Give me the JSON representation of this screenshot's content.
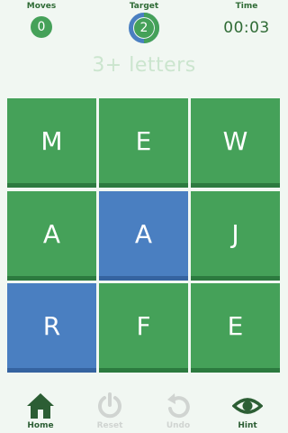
{
  "header": {
    "moves": {
      "label": "Moves",
      "value": "0"
    },
    "target": {
      "label": "Target",
      "value": "2"
    },
    "time": {
      "label": "Time",
      "value": "00:03"
    }
  },
  "hint_text": "3+ letters",
  "grid": {
    "tiles": [
      {
        "letter": "M",
        "selected": false
      },
      {
        "letter": "E",
        "selected": false
      },
      {
        "letter": "W",
        "selected": false
      },
      {
        "letter": "A",
        "selected": false
      },
      {
        "letter": "A",
        "selected": true
      },
      {
        "letter": "J",
        "selected": false
      },
      {
        "letter": "R",
        "selected": true
      },
      {
        "letter": "F",
        "selected": false
      },
      {
        "letter": "E",
        "selected": false
      }
    ]
  },
  "bottom_bar": {
    "home": {
      "label": "Home",
      "icon": "home-icon",
      "enabled": true
    },
    "reset": {
      "label": "Reset",
      "icon": "power-icon",
      "enabled": false
    },
    "undo": {
      "label": "Undo",
      "icon": "undo-icon",
      "enabled": false
    },
    "hint": {
      "label": "Hint",
      "icon": "eye-icon",
      "enabled": true
    }
  },
  "colors": {
    "background": "#f1f7f2",
    "tile": "#45a159",
    "tile_shadow": "#2c7a3f",
    "tile_selected": "#4a7fc1",
    "tile_selected_shadow": "#3563a0",
    "text_dark": "#2f6b35",
    "hint_text": "#cbe5ce",
    "disabled": "#d0d4d1"
  }
}
